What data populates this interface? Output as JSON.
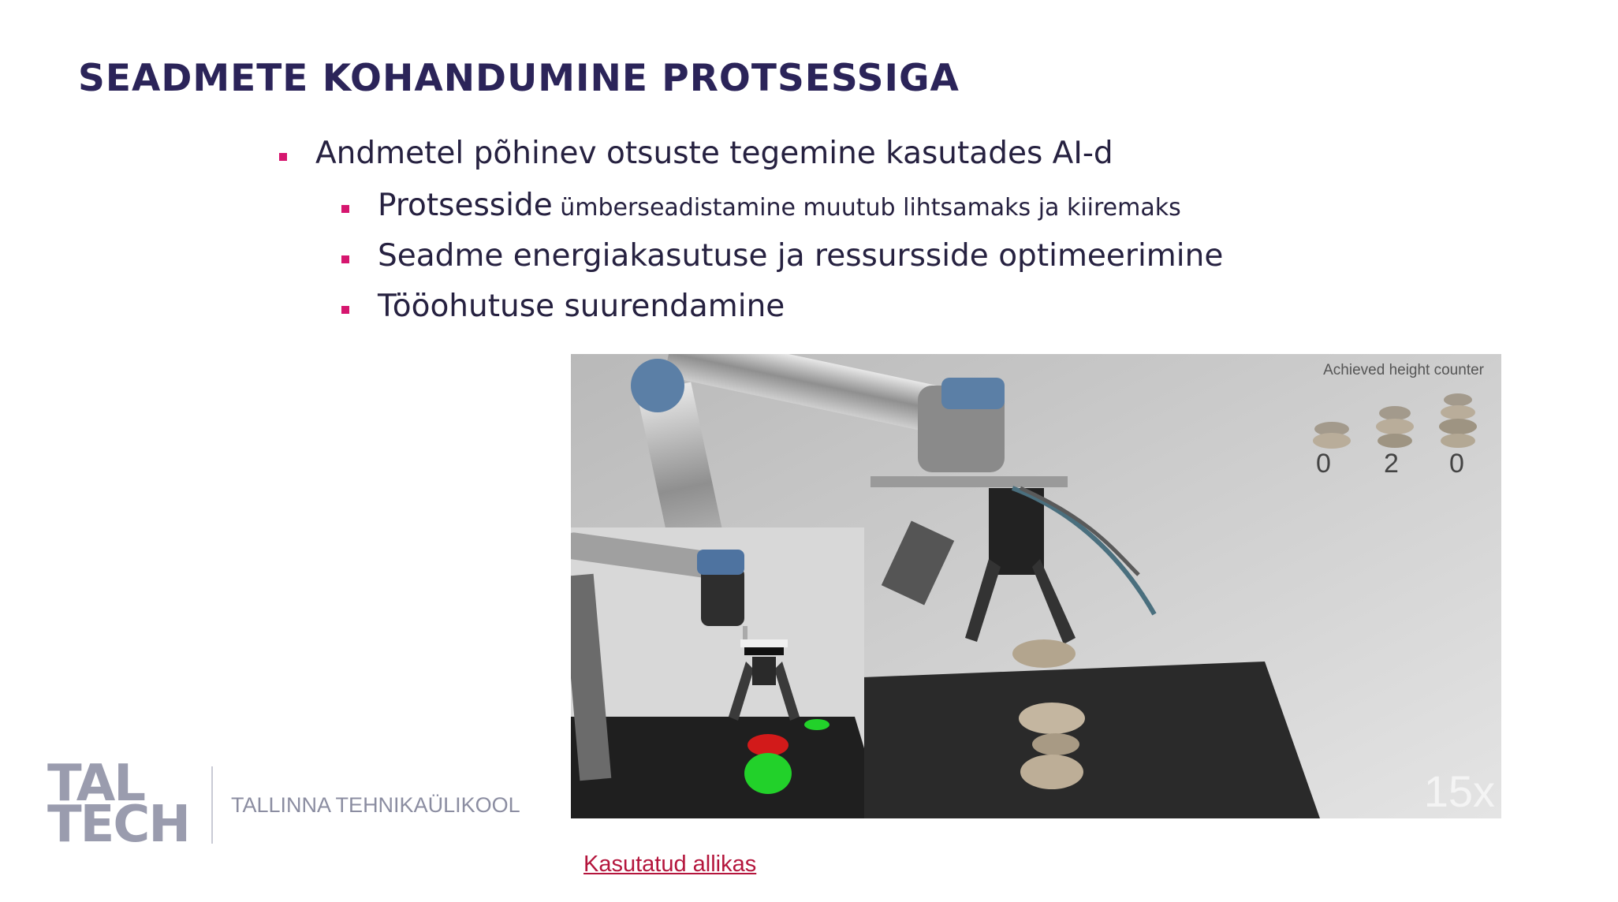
{
  "slide": {
    "title": "SEADMETE KOHANDUMINE PROTSESSIGA",
    "bullets": {
      "main": "Andmetel põhinev otsuste tegemine kasutades AI-d",
      "sub1_lead": "Protsesside",
      "sub1_rest": " ümberseadistamine muutub lihtsamaks ja kiiremaks",
      "sub2": "Seadme energiakasutuse ja ressursside optimeerimine",
      "sub3": "Tööohutuse suurendamine"
    }
  },
  "video": {
    "counter_label": "Achieved height counter",
    "counts": [
      "0",
      "2",
      "0"
    ],
    "speed": "15x"
  },
  "footer": {
    "logo_line1": "TAL",
    "logo_line2": "TECH",
    "university": "TALLINNA TEHNIKAÜLIKOOL",
    "source_link": "Kasutatud allikas"
  },
  "colors": {
    "title": "#2b2459",
    "bullet_marker": "#d6166f",
    "link": "#b4153c"
  }
}
